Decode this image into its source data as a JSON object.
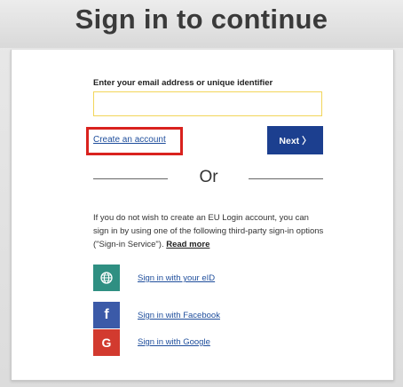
{
  "header": {
    "title": "Sign in to continue"
  },
  "form": {
    "email_label": "Enter your email address or unique identifier",
    "email_value": "",
    "create_account_label": "Create an account",
    "next_label": "Next 〉"
  },
  "divider": {
    "or_label": "Or"
  },
  "info": {
    "text": "If you do not wish to create an EU Login account, you can sign in by using one of the following third-party sign-in options (\"Sign-in Service\"). ",
    "read_more": "Read more"
  },
  "sign_in_options": [
    {
      "label": "Sign in with your eID",
      "icon": "globe-icon",
      "color": "#2f8f82"
    },
    {
      "label": "Sign in with Facebook",
      "icon": "facebook-icon",
      "color": "#3b5aa8"
    },
    {
      "label": "Sign in with Google",
      "icon": "google-icon",
      "color": "#d23a2f"
    }
  ],
  "colors": {
    "next_button": "#1c3f8f",
    "highlight_box": "#d9221e",
    "input_border": "#f2d55a",
    "link": "#1f4e9c"
  }
}
